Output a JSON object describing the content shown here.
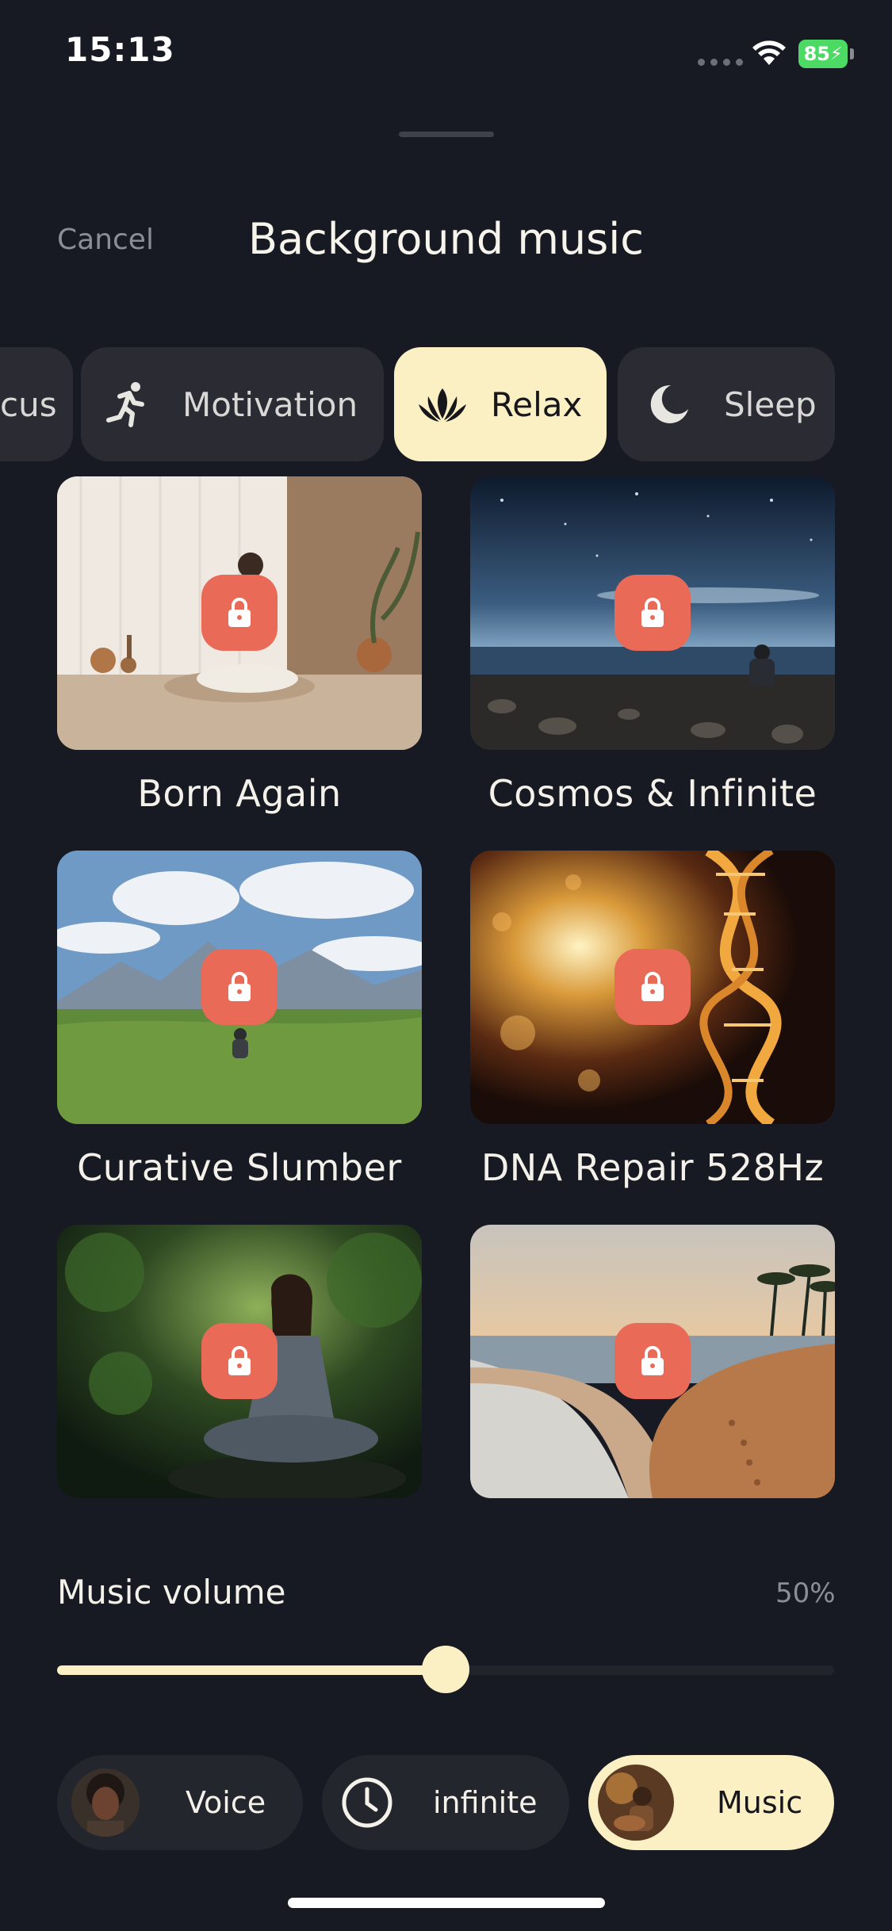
{
  "status_bar": {
    "time": "15:13",
    "battery": "85"
  },
  "header": {
    "cancel_label": "Cancel",
    "title": "Background music"
  },
  "tabs": [
    {
      "label": "cus",
      "icon": "focus-icon",
      "active": false
    },
    {
      "label": "Motivation",
      "icon": "running-icon",
      "active": false
    },
    {
      "label": "Relax",
      "icon": "lotus-icon",
      "active": true
    },
    {
      "label": "Sleep",
      "icon": "moon-icon",
      "active": false
    }
  ],
  "tracks": [
    {
      "title": "Born Again",
      "locked": true
    },
    {
      "title": "Cosmos & Infinite",
      "locked": true
    },
    {
      "title": "Curative Slumber",
      "locked": true
    },
    {
      "title": "DNA Repair 528Hz",
      "locked": true
    },
    {
      "title": "",
      "locked": true
    },
    {
      "title": "",
      "locked": true
    }
  ],
  "volume": {
    "label": "Music volume",
    "value_text": "50%",
    "level": 0.5
  },
  "bottom_bar": {
    "voice_label": "Voice",
    "duration_label": "infinite",
    "music_label": "Music",
    "active": "Music"
  },
  "colors": {
    "background": "#181a23",
    "accent": "#fbefc4",
    "lock": "#ea6a58",
    "surface": "#2a2b33"
  }
}
